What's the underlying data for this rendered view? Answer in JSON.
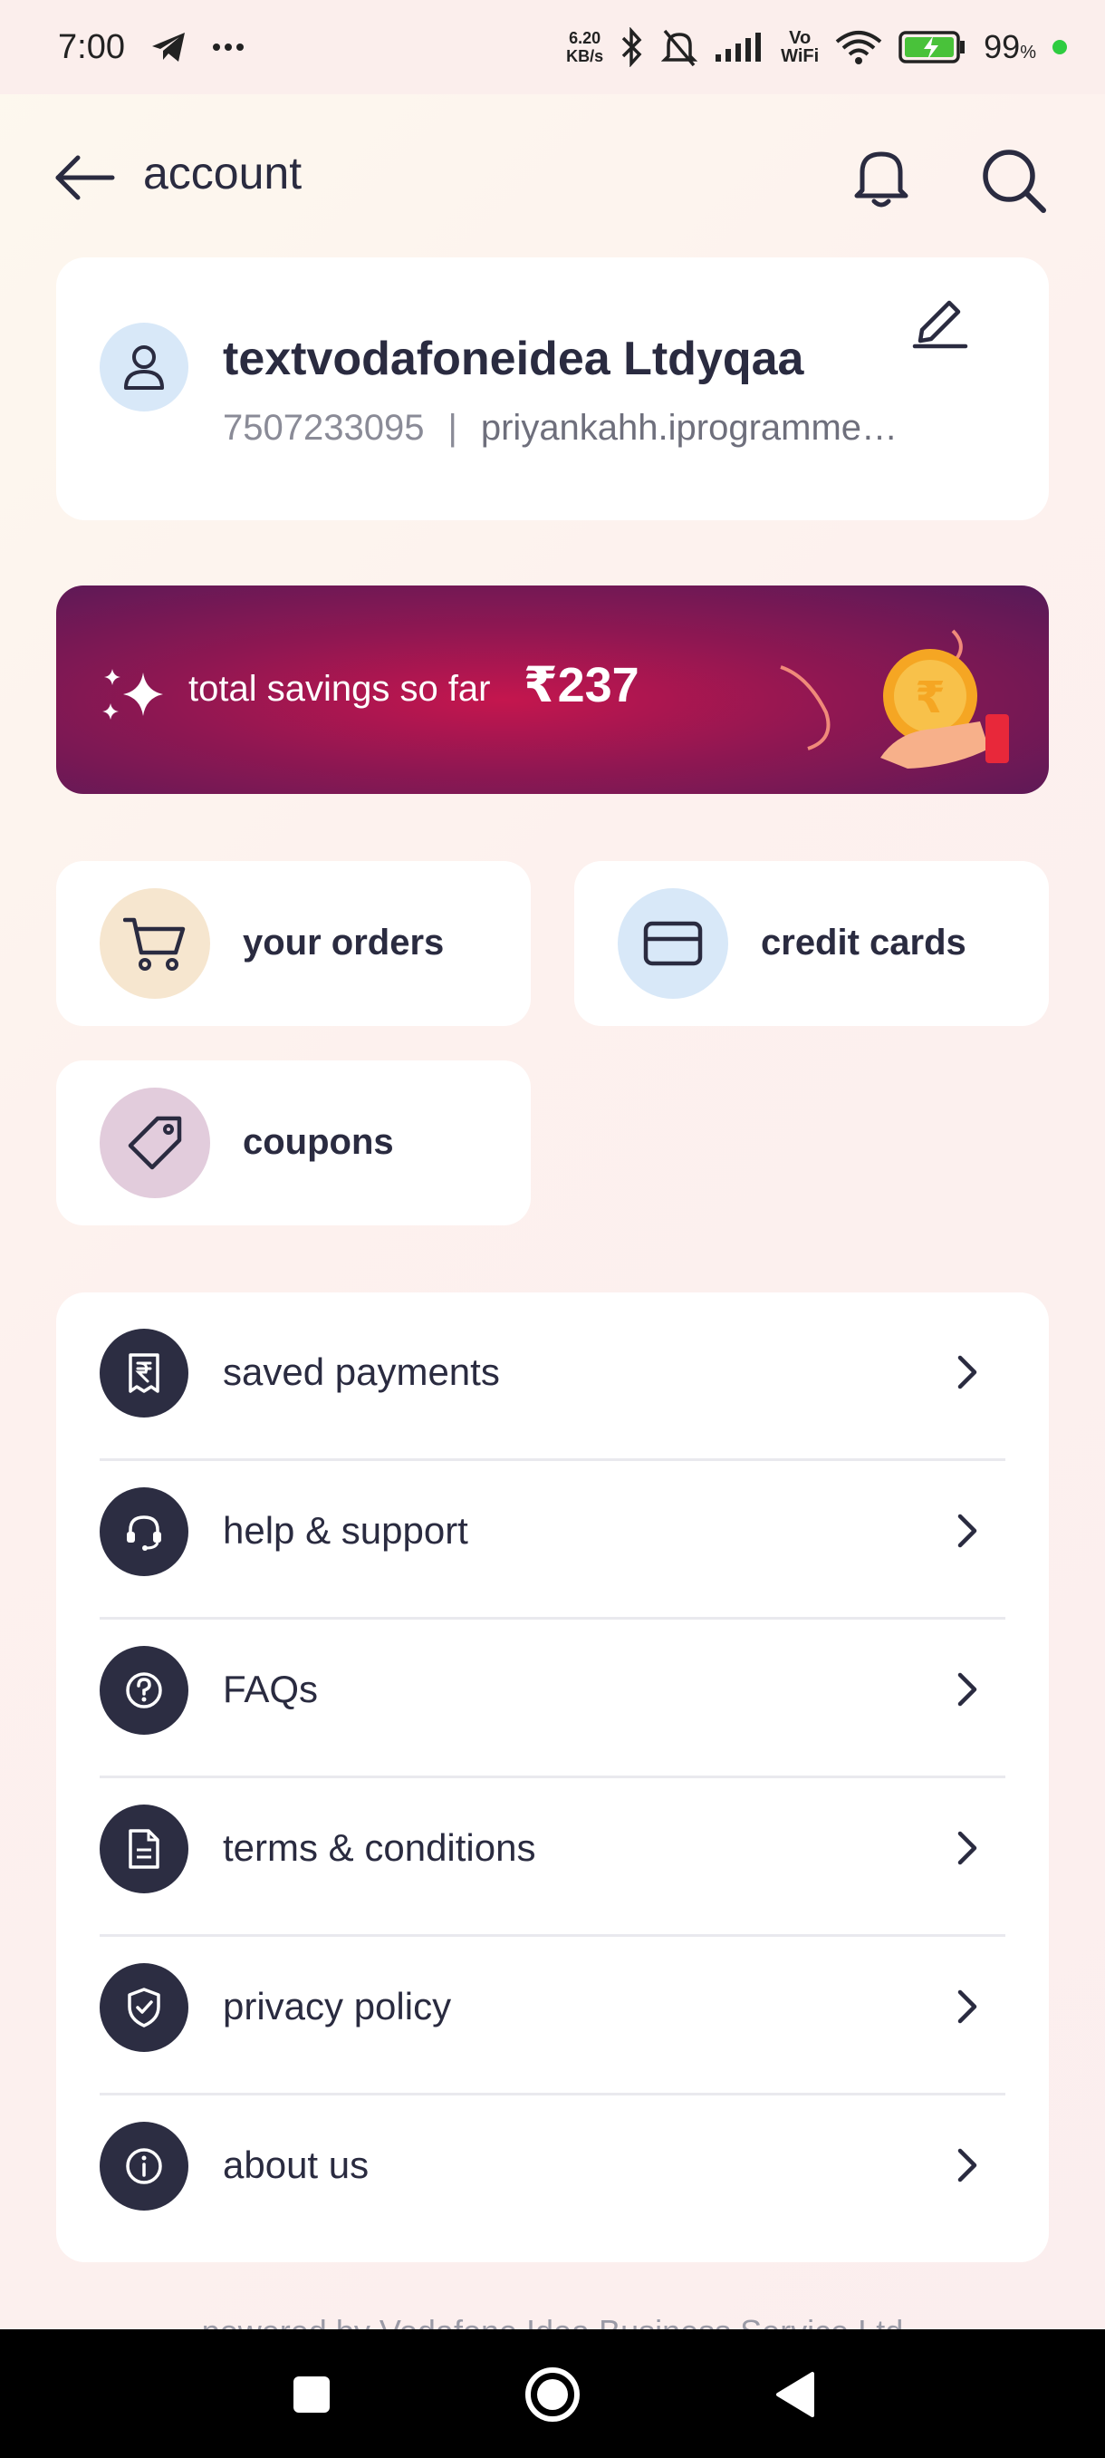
{
  "status_bar": {
    "time": "7:00",
    "network_speed_value": "6.20",
    "network_speed_unit": "KB/s",
    "volte_label_top": "Vo",
    "volte_label_bottom": "WiFi",
    "battery_percent": "99",
    "battery_suffix": "%"
  },
  "header": {
    "title": "account"
  },
  "profile": {
    "name": "textvodafoneidea Ltdyqaa",
    "phone": "7507233095",
    "separator": "|",
    "email": "priyankahh.iprogramme…"
  },
  "savings": {
    "label": "total savings so far",
    "amount": "₹237"
  },
  "quick_tiles": {
    "orders": "your orders",
    "credit_cards": "credit cards",
    "coupons": "coupons"
  },
  "menu": {
    "items": [
      {
        "label": "saved payments",
        "icon": "receipt-rupee-icon"
      },
      {
        "label": "help & support",
        "icon": "headset-icon"
      },
      {
        "label": "FAQs",
        "icon": "question-circle-icon"
      },
      {
        "label": "terms & conditions",
        "icon": "document-icon"
      },
      {
        "label": "privacy policy",
        "icon": "shield-check-icon"
      },
      {
        "label": "about us",
        "icon": "info-icon"
      }
    ]
  },
  "footer": {
    "text": "powered by Vodafone Idea Business Service Ltd"
  },
  "colors": {
    "icon_dark": "#2c2d42",
    "orders_bg": "#f6e6cf",
    "cards_bg": "#d8e8f8",
    "coupons_bg": "#e2ccdc",
    "savings_start": "#c4164e",
    "savings_end": "#551a58"
  }
}
